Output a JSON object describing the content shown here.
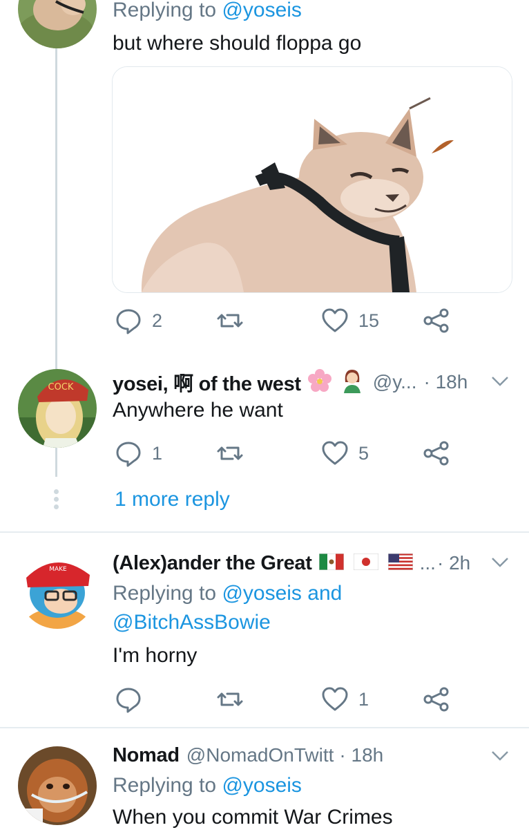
{
  "tweet1": {
    "replying_prefix": "Replying to",
    "replying_handle": "@yoseis",
    "text": "but where should floppa go",
    "counts": {
      "reply": "2",
      "like": "15"
    }
  },
  "tweet2": {
    "name": "yosei, 啊 of the west",
    "handle": "@y...",
    "time": "· 18h",
    "text": "Anywhere he want",
    "counts": {
      "reply": "1",
      "like": "5"
    },
    "more_replies": "1 more reply"
  },
  "tweet3": {
    "name": "(Alex)ander the Great",
    "ellipsis": "...",
    "time": "· 2h",
    "replying_prefix": "Replying to",
    "replying_handle_1": "@yoseis",
    "replying_and": "and",
    "replying_handle_2": "@BitchAssBowie",
    "text": "I'm horny",
    "counts": {
      "like": "1"
    }
  },
  "tweet4": {
    "name": "Nomad",
    "handle": "@NomadOnTwitt",
    "time": "· 18h",
    "replying_prefix": "Replying to",
    "replying_handle": "@yoseis",
    "text": "When you commit War Crimes"
  },
  "colors": {
    "link": "#1b95e0",
    "muted": "#657786",
    "divider": "#e6ecf0",
    "thread_line": "#cfd9de"
  }
}
